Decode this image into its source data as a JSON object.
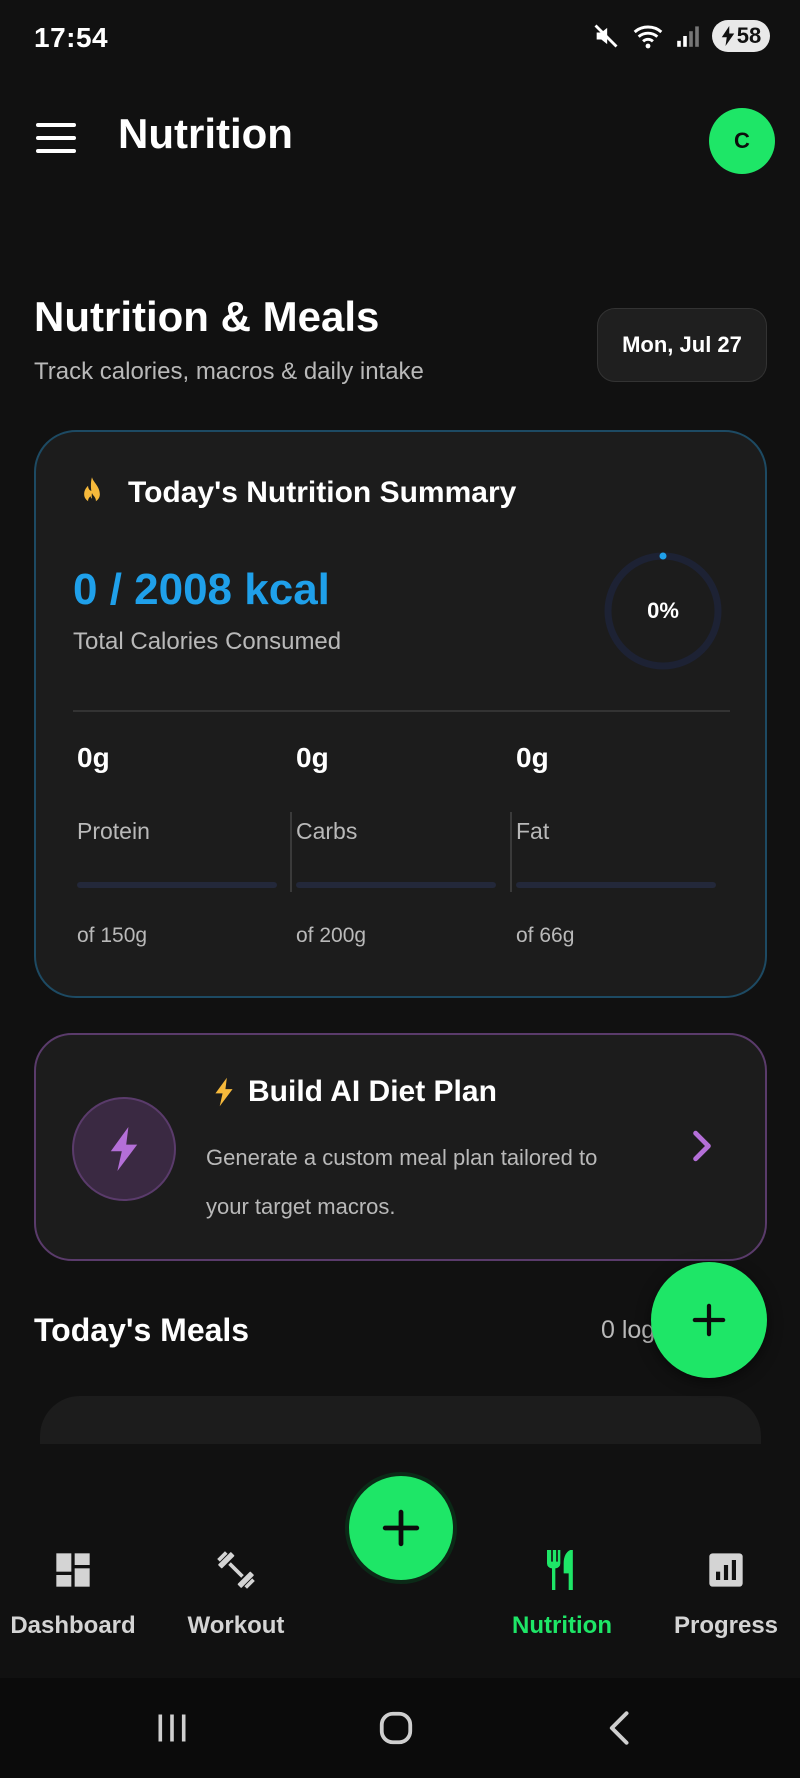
{
  "status_bar": {
    "time": "17:54",
    "battery": "58"
  },
  "app_bar": {
    "title": "Nutrition",
    "avatar_initial": "C"
  },
  "page": {
    "title": "Nutrition & Meals",
    "subtitle": "Track calories, macros & daily intake",
    "date": "Mon, Jul 27"
  },
  "summary": {
    "title": "Today's Nutrition Summary",
    "calories": "0 / 2008 kcal",
    "calories_label": "Total Calories Consumed",
    "progress_label": "0%",
    "progress_fraction": 0,
    "macros": [
      {
        "value": "0g",
        "name": "Protein",
        "goal": "of 150g",
        "fraction": 0
      },
      {
        "value": "0g",
        "name": "Carbs",
        "goal": "of 200g",
        "fraction": 0
      },
      {
        "value": "0g",
        "name": "Fat",
        "goal": "of 66g",
        "fraction": 0
      }
    ]
  },
  "ai_plan": {
    "title": "Build AI Diet Plan",
    "description": "Generate a custom meal plan tailored to your target macros."
  },
  "meals": {
    "title": "Today's Meals",
    "count": "0 log"
  },
  "nav": {
    "items": [
      {
        "label": "Dashboard"
      },
      {
        "label": "Workout"
      },
      {
        "label": "Nutrition"
      },
      {
        "label": "Progress"
      }
    ]
  },
  "colors": {
    "accent_green": "#1ee667",
    "accent_blue": "#1fa0ea",
    "accent_purple": "#b46fd8",
    "flame": "#f6b93b"
  },
  "icons": {
    "menu": "hamburger-icon",
    "flame": "flame-icon",
    "bolt": "lightning-icon",
    "chevron": "chevron-right-icon",
    "add": "plus-icon",
    "dashboard": "dashboard-icon",
    "workout": "dumbbell-icon",
    "nutrition": "fork-knife-icon",
    "progress": "bar-chart-icon"
  }
}
